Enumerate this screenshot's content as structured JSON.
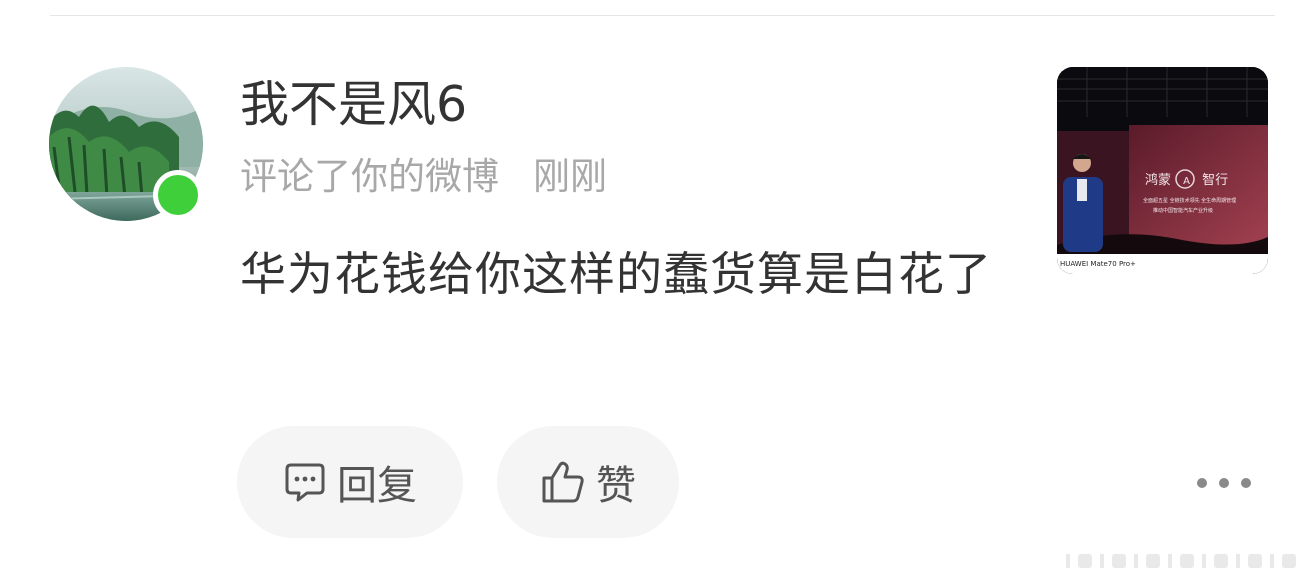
{
  "notification": {
    "username": "我不是风6",
    "action": "评论了你的微博",
    "time": "刚刚",
    "comment": "华为花钱给你这样的蠢货算是白花了",
    "avatar_status_color": "#3fcf3a"
  },
  "actions": {
    "reply_label": "回复",
    "like_label": "赞",
    "more_icon": "more-dots-icon"
  },
  "thumbnail": {
    "stage_line1_left": "鸿蒙",
    "stage_logo_letter": "A",
    "stage_line1_right": "智行",
    "stage_line2": "全面超五星 全链技术领先 全生命周期管理",
    "stage_line3": "推动中国智能汽车产业升级",
    "camera_watermark": "HUAWEI Mate70 Pro+"
  }
}
